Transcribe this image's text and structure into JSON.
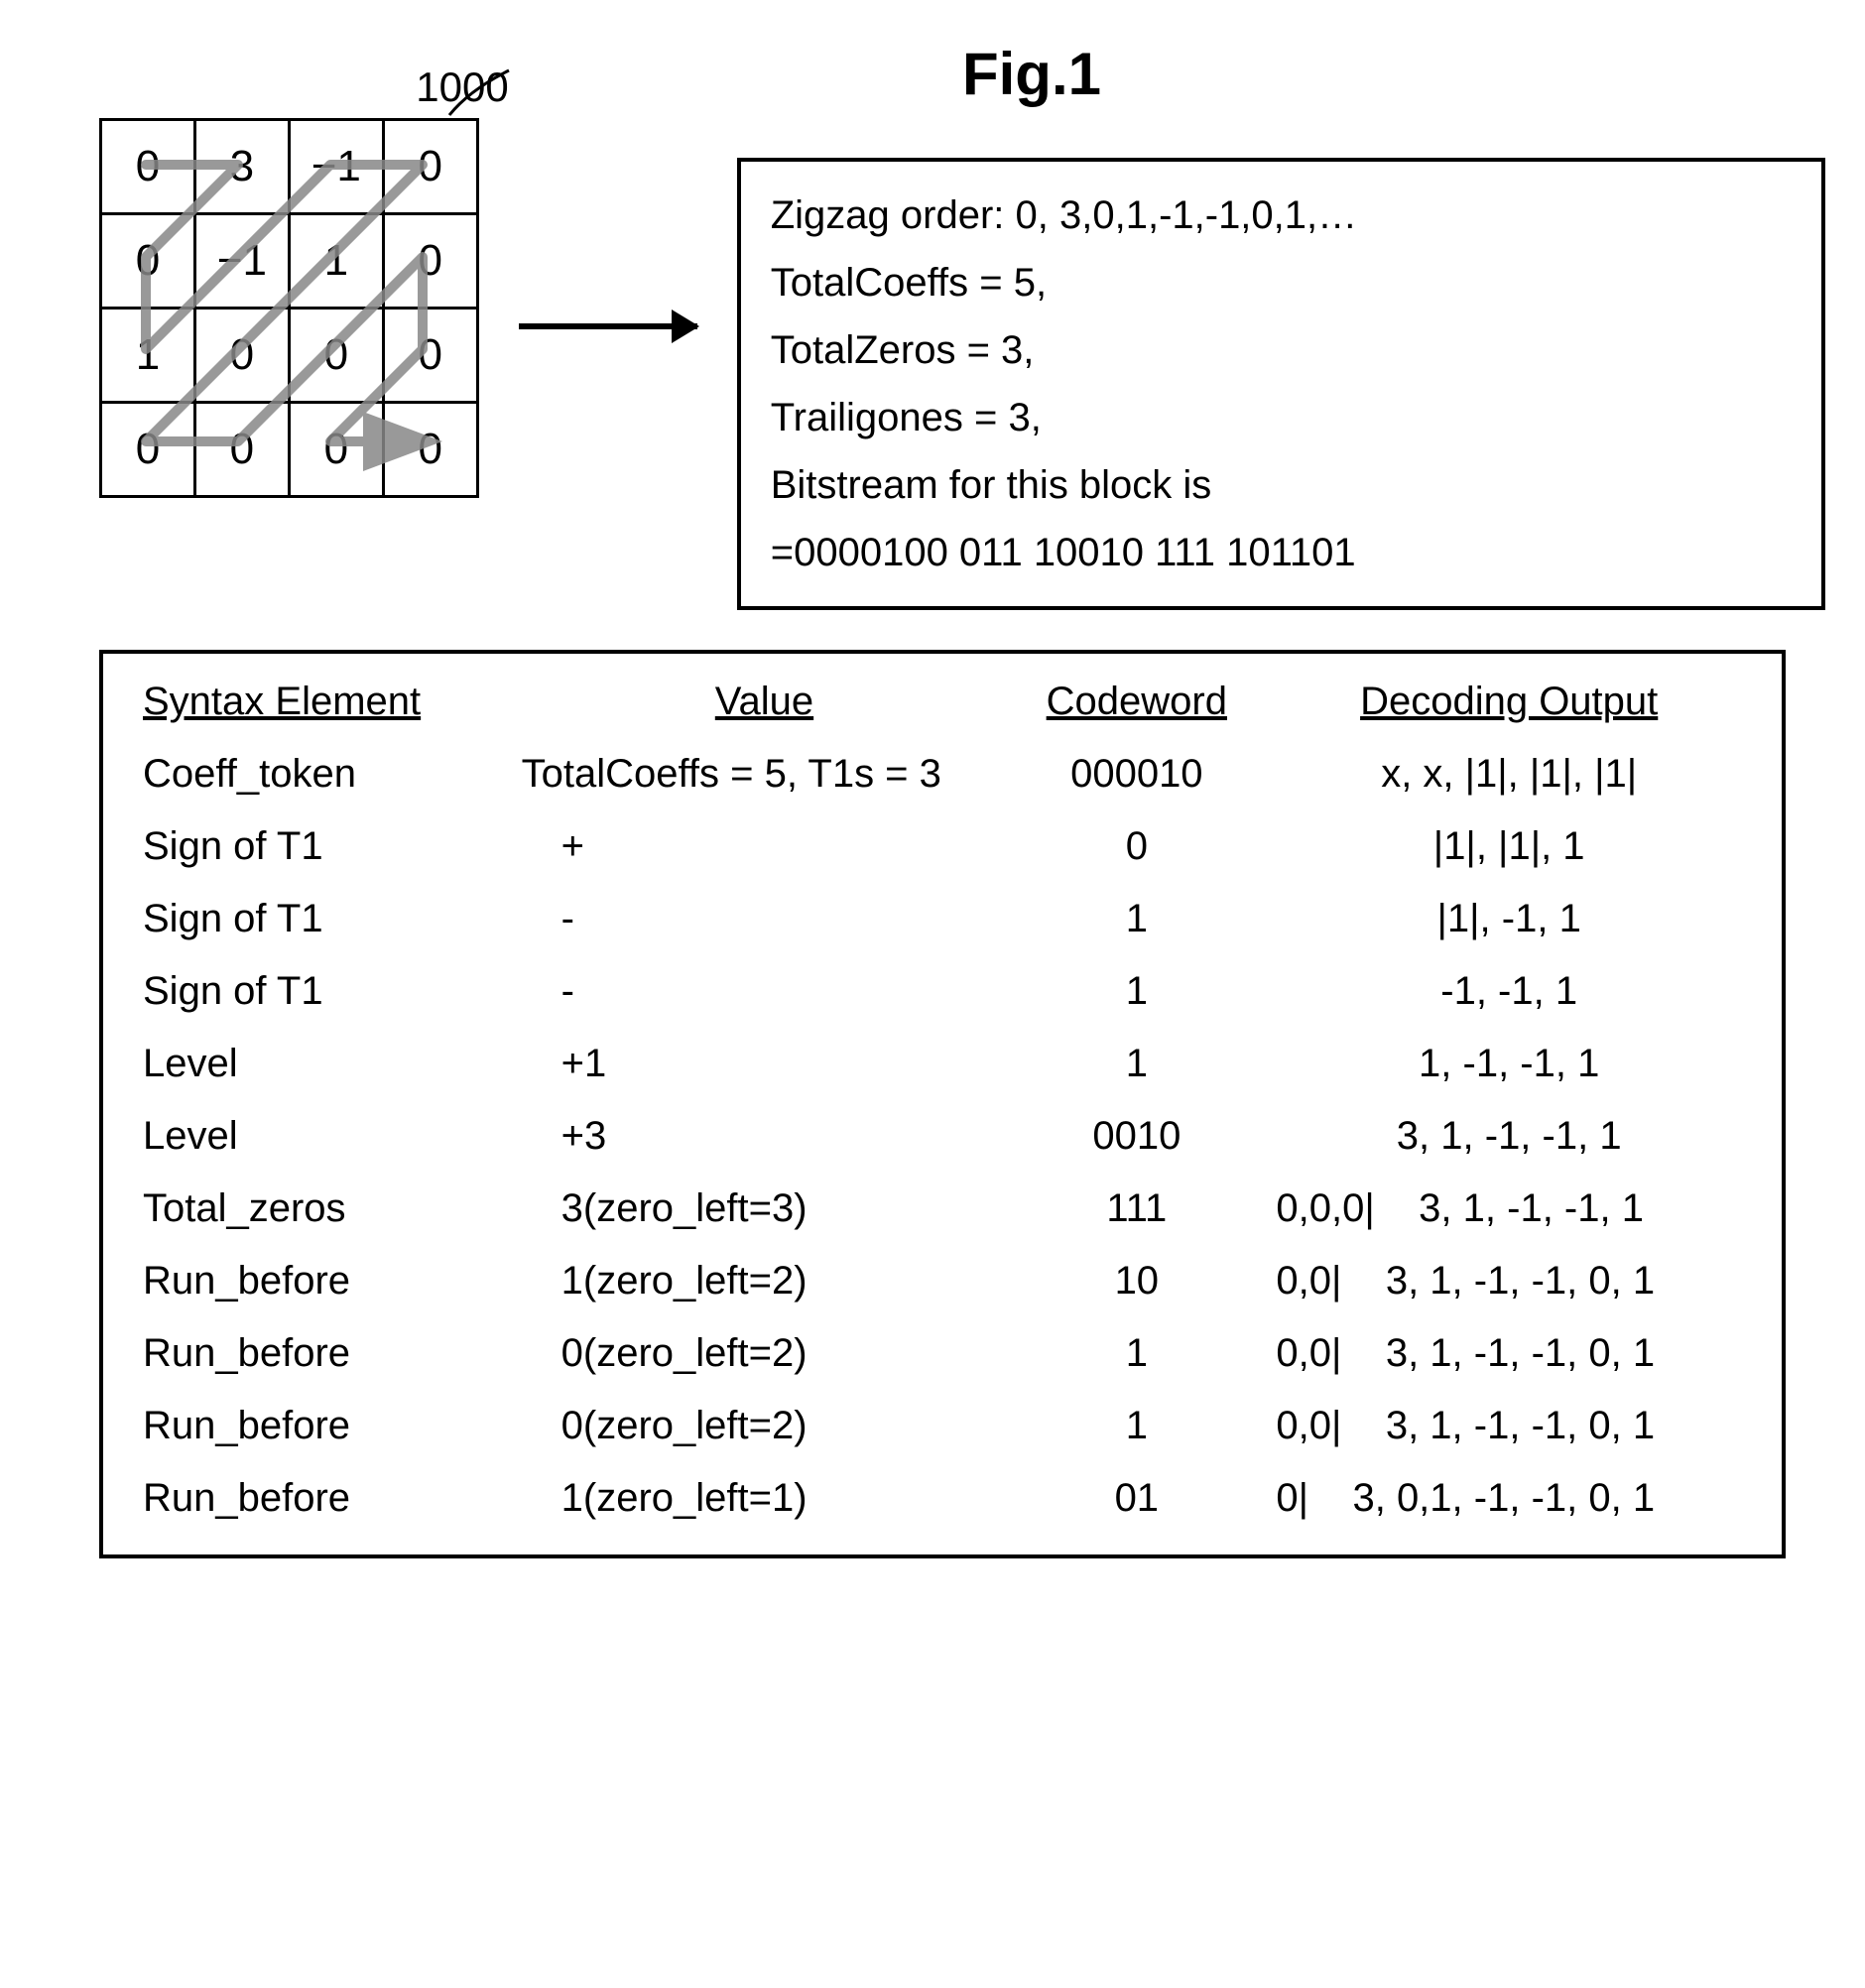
{
  "title": "Fig.1",
  "matrix_label": "1000",
  "matrix_cells": [
    [
      "0",
      "3",
      "−1",
      "0"
    ],
    [
      "0",
      "−1",
      "1",
      "0"
    ],
    [
      "1",
      "0",
      "0",
      "0"
    ],
    [
      "0",
      "0",
      "0",
      "0"
    ]
  ],
  "info_lines": [
    "Zigzag order: 0, 3,0,1,-1,-1,0,1,…",
    "TotalCoeffs = 5,",
    "TotalZeros = 3,",
    "Trailigones = 3,",
    "Bitstream for this block is",
    "=0000100 011 10010 111 101101"
  ],
  "syntax_headers": [
    "Syntax Element",
    "Value",
    "Codeword",
    "Decoding Output"
  ],
  "syntax_rows": [
    {
      "el": "Coeff_token",
      "val": "TotalCoeffs = 5, T1s = 3",
      "code": "000010",
      "out": "x, x, |1|, |1|, |1|"
    },
    {
      "el": "Sign of T1",
      "val": "+",
      "code": "0",
      "out": "|1|, |1|, 1"
    },
    {
      "el": "Sign of T1",
      "val": "-",
      "code": "1",
      "out": "|1|, -1, 1"
    },
    {
      "el": "Sign of T1",
      "val": "-",
      "code": "1",
      "out": "-1, -1, 1"
    },
    {
      "el": "Level",
      "val": "+1",
      "code": "1",
      "out": "1, -1, -1, 1"
    },
    {
      "el": "Level",
      "val": "+3",
      "code": "0010",
      "out": "3, 1, -1, -1, 1"
    },
    {
      "el": "Total_zeros",
      "val": "3(zero_left=3)",
      "code": "111",
      "out": "0,0,0|    3, 1, -1, -1, 1"
    },
    {
      "el": "Run_before",
      "val": "1(zero_left=2)",
      "code": "10",
      "out": "0,0|    3, 1, -1, -1, 0, 1"
    },
    {
      "el": "Run_before",
      "val": "0(zero_left=2)",
      "code": "1",
      "out": "0,0|    3, 1, -1, -1, 0, 1"
    },
    {
      "el": "Run_before",
      "val": "0(zero_left=2)",
      "code": "1",
      "out": "0,0|    3, 1, -1, -1, 0, 1"
    },
    {
      "el": "Run_before",
      "val": "1(zero_left=1)",
      "code": "01",
      "out": "0|    3, 0,1, -1, -1, 0, 1"
    }
  ],
  "chart_data": {
    "type": "table",
    "matrix": [
      [
        0,
        3,
        -1,
        0
      ],
      [
        0,
        -1,
        1,
        0
      ],
      [
        1,
        0,
        0,
        0
      ],
      [
        0,
        0,
        0,
        0
      ]
    ],
    "zigzag_order": [
      0,
      3,
      0,
      1,
      -1,
      -1,
      0,
      1
    ],
    "TotalCoeffs": 5,
    "TotalZeros": 3,
    "TrailingOnes": 3,
    "bitstream": "0000100 011 10010 111 101101",
    "decoding_steps": [
      {
        "syntax": "Coeff_token",
        "value": "TotalCoeffs=5,T1s=3",
        "codeword": "000010",
        "output": "x,x,|1|,|1|,|1|"
      },
      {
        "syntax": "Sign of T1",
        "value": "+",
        "codeword": "0",
        "output": "|1|,|1|,1"
      },
      {
        "syntax": "Sign of T1",
        "value": "-",
        "codeword": "1",
        "output": "|1|,-1,1"
      },
      {
        "syntax": "Sign of T1",
        "value": "-",
        "codeword": "1",
        "output": "-1,-1,1"
      },
      {
        "syntax": "Level",
        "value": "+1",
        "codeword": "1",
        "output": "1,-1,-1,1"
      },
      {
        "syntax": "Level",
        "value": "+3",
        "codeword": "0010",
        "output": "3,1,-1,-1,1"
      },
      {
        "syntax": "Total_zeros",
        "value": "3(zero_left=3)",
        "codeword": "111",
        "output": "0,0,0| 3,1,-1,-1,1"
      },
      {
        "syntax": "Run_before",
        "value": "1(zero_left=2)",
        "codeword": "10",
        "output": "0,0| 3,1,-1,-1,0,1"
      },
      {
        "syntax": "Run_before",
        "value": "0(zero_left=2)",
        "codeword": "1",
        "output": "0,0| 3,1,-1,-1,0,1"
      },
      {
        "syntax": "Run_before",
        "value": "0(zero_left=2)",
        "codeword": "1",
        "output": "0,0| 3,1,-1,-1,0,1"
      },
      {
        "syntax": "Run_before",
        "value": "1(zero_left=1)",
        "codeword": "01",
        "output": "0| 3,0,1,-1,-1,0,1"
      }
    ]
  }
}
